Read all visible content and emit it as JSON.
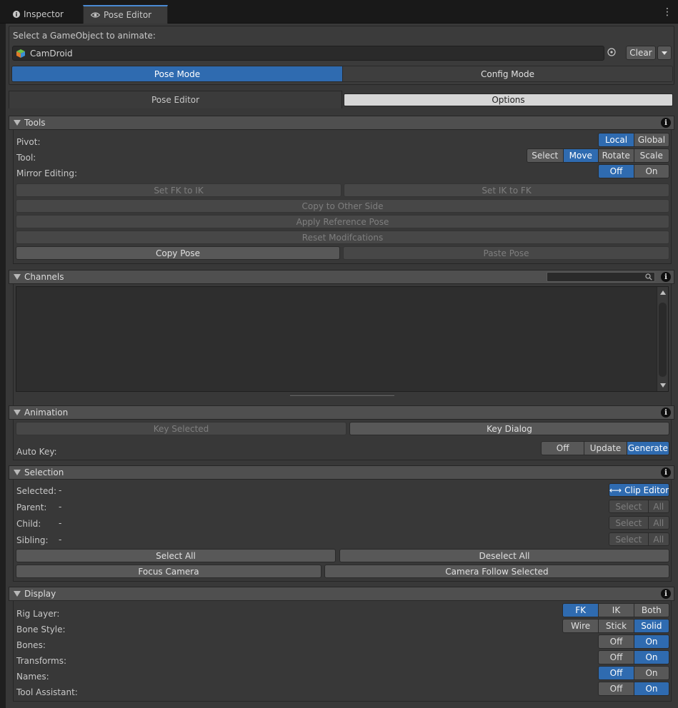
{
  "window": {
    "tabs": [
      {
        "label": "Inspector",
        "icon": "info-icon"
      },
      {
        "label": "Pose Editor",
        "icon": "eye-icon"
      }
    ],
    "menu_icon": "kebab-icon"
  },
  "target": {
    "prompt": "Select a GameObject to animate:",
    "object_name": "CamDroid",
    "clear_label": "Clear"
  },
  "modes": [
    "Pose Mode",
    "Config Mode"
  ],
  "subtabs": [
    "Pose Editor",
    "Options"
  ],
  "tools": {
    "header": "Tools",
    "pivot_label": "Pivot:",
    "pivot_options": [
      "Local",
      "Global"
    ],
    "tool_label": "Tool:",
    "tool_options": [
      "Select",
      "Move",
      "Rotate",
      "Scale"
    ],
    "mirror_label": "Mirror Editing:",
    "mirror_options": [
      "Off",
      "On"
    ],
    "fk_to_ik": "Set FK to IK",
    "ik_to_fk": "Set IK to FK",
    "copy_other_side": "Copy to Other Side",
    "apply_reference": "Apply Reference Pose",
    "reset_mods": "Reset Modifcations",
    "copy_pose": "Copy Pose",
    "paste_pose": "Paste Pose"
  },
  "channels": {
    "header": "Channels",
    "search_placeholder": ""
  },
  "animation": {
    "header": "Animation",
    "key_selected": "Key Selected",
    "key_dialog": "Key Dialog",
    "auto_key_label": "Auto Key:",
    "auto_key_options": [
      "Off",
      "Update",
      "Generate"
    ]
  },
  "selection": {
    "header": "Selection",
    "rows": [
      {
        "label": "Selected:",
        "value": "-"
      },
      {
        "label": "Parent:",
        "value": "-"
      },
      {
        "label": "Child:",
        "value": "-"
      },
      {
        "label": "Sibling:",
        "value": "-"
      }
    ],
    "clip_editor": "Clip Editor",
    "select_label": "Select",
    "all_label": "All",
    "select_all": "Select All",
    "deselect_all": "Deselect All",
    "focus_camera": "Focus Camera",
    "camera_follow": "Camera Follow Selected"
  },
  "display": {
    "header": "Display",
    "rows": [
      {
        "label": "Rig Layer:",
        "options": [
          "FK",
          "IK",
          "Both"
        ]
      },
      {
        "label": "Bone Style:",
        "options": [
          "Wire",
          "Stick",
          "Solid"
        ]
      },
      {
        "label": "Bones:",
        "options": [
          "Off",
          "On"
        ]
      },
      {
        "label": "Transforms:",
        "options": [
          "Off",
          "On"
        ]
      },
      {
        "label": "Names:",
        "options": [
          "Off",
          "On"
        ]
      },
      {
        "label": "Tool Assistant:",
        "options": [
          "Off",
          "On"
        ]
      }
    ]
  },
  "colors": {
    "accent": "#2f6bb0",
    "panel": "#383838",
    "header": "#4f4f4f"
  }
}
